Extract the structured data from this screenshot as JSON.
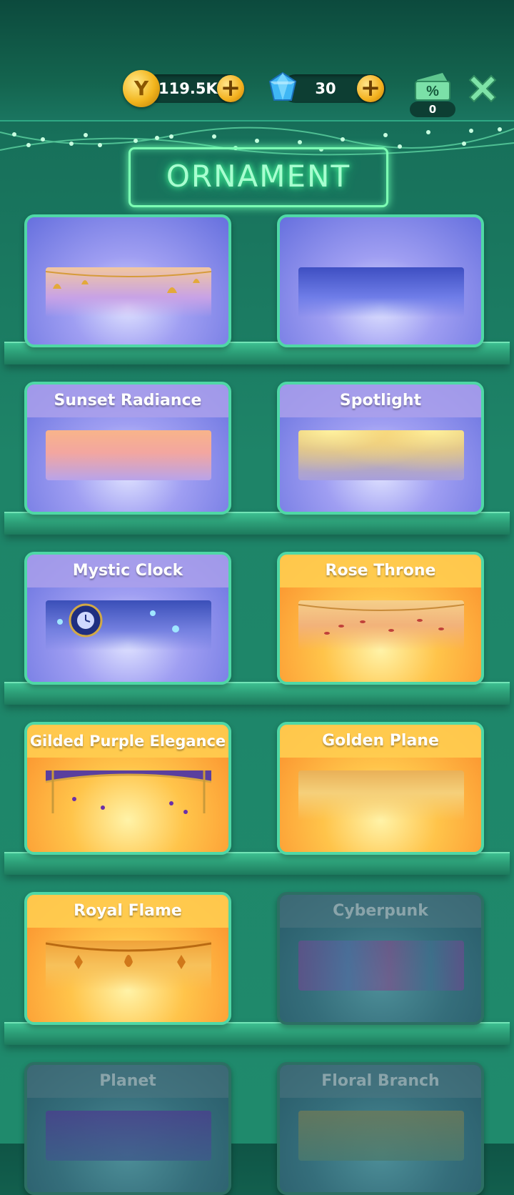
{
  "header": {
    "coins": "119.5K",
    "gems": "30",
    "tickets": "0",
    "ticket_symbol": "%",
    "coin_symbol": "Y"
  },
  "sign": {
    "title": "ORNAMENT"
  },
  "cards": [
    {
      "label": "",
      "theme": "purple"
    },
    {
      "label": "",
      "theme": "purple"
    },
    {
      "label": "Sunset Radiance",
      "theme": "purple"
    },
    {
      "label": "Spotlight",
      "theme": "purple"
    },
    {
      "label": "Mystic Clock",
      "theme": "purple"
    },
    {
      "label": "Rose Throne",
      "theme": "orange"
    },
    {
      "label": "Gilded Purple Elegance",
      "theme": "orange"
    },
    {
      "label": "Golden Plane",
      "theme": "orange"
    },
    {
      "label": "Royal Flame",
      "theme": "orange"
    },
    {
      "label": "Cyberpunk",
      "theme": "locked"
    },
    {
      "label": "Planet",
      "theme": "locked"
    },
    {
      "label": "Floral Branch",
      "theme": "locked"
    }
  ],
  "colors": {
    "accent_green": "#4fd8a6",
    "neon": "#7dffb4",
    "coin_gold": "#f2b51d",
    "gem_blue": "#3fb7f5"
  }
}
